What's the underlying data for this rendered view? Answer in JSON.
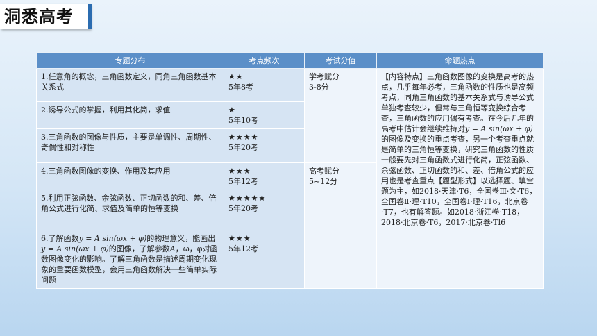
{
  "slide_title": "洞悉高考",
  "table": {
    "headers": [
      "专题分布",
      "考点频次",
      "考试分值",
      "命题热点"
    ],
    "rows": [
      {
        "topic": "1.任意角的概念，三角函数定义，同角三角函数基本关系式",
        "stars": "★★",
        "freq": "5年8考"
      },
      {
        "topic": "2.诱导公式的掌握，利用其化简，求值",
        "stars": "★",
        "freq": "5年10考"
      },
      {
        "topic": "3.三角函数的图像与性质，主要是单调性、周期性、奇偶性和对称性",
        "stars": "★★★★",
        "freq": "5年20考"
      },
      {
        "topic": "4.三角函数图像的变换、作用及其应用",
        "stars": "★★★",
        "freq": "5年12考"
      },
      {
        "topic": "5.利用正弦函数、余弦函数、正切函数的和、差、倍角公式进行化简、求值及简单的恒等变换",
        "stars": "★★★★★",
        "freq": "5年20考"
      },
      {
        "topic_a": "6.了解函数",
        "topic_m1": "y = A sin(ωx + φ)",
        "topic_b": "的物理意义，能画出",
        "topic_m2": "y = A sin(ωx + φ)",
        "topic_c": "的图像，了解参数",
        "topic_m3": "A",
        "topic_d": "，ω，φ对函数图像变化的影响。了解三角函数是描述周期变化现象的重要函数模型，会用三角函数解决一些简单实际问题",
        "stars": "★★★",
        "freq": "5年12考"
      }
    ],
    "score_group1": {
      "line1": "学考赋分",
      "line2": "3-8分"
    },
    "score_group2": {
      "line1": "高考赋分",
      "line2": "5~12分"
    },
    "hot_a": "【内容特点】三角函数图像的变换是高考的热点，几乎每年必考，三角函数的性质也是高频考点，同角三角函数的基本关系式与诱导公式单独考查较少，但常与三角恒等变换综合考查，三角函数的应用偶有考查。在今后几年的高考中估计会继续维持对",
    "hot_math": "y = A sin(ωx + φ)",
    "hot_b": "的图像及变换的重点考查，另一个考查重点就是简单的三角恒等变换，研究三角函数的性质一般要先对三角函数式进行化简，正弦函数、余弦函数、正切函数的和、差、倍角公式的应用也是考查重点【题型形式】以选择题、填空题为主，如2018·天津·T6，全国卷Ⅲ·文·T6，全国卷Ⅱ·理·T10，全国卷Ⅰ·理·T16，北京卷·T7，也有解答题。如2018·浙江卷·T18，2018·北京卷·T6，2017·北京卷·Tl6"
  }
}
